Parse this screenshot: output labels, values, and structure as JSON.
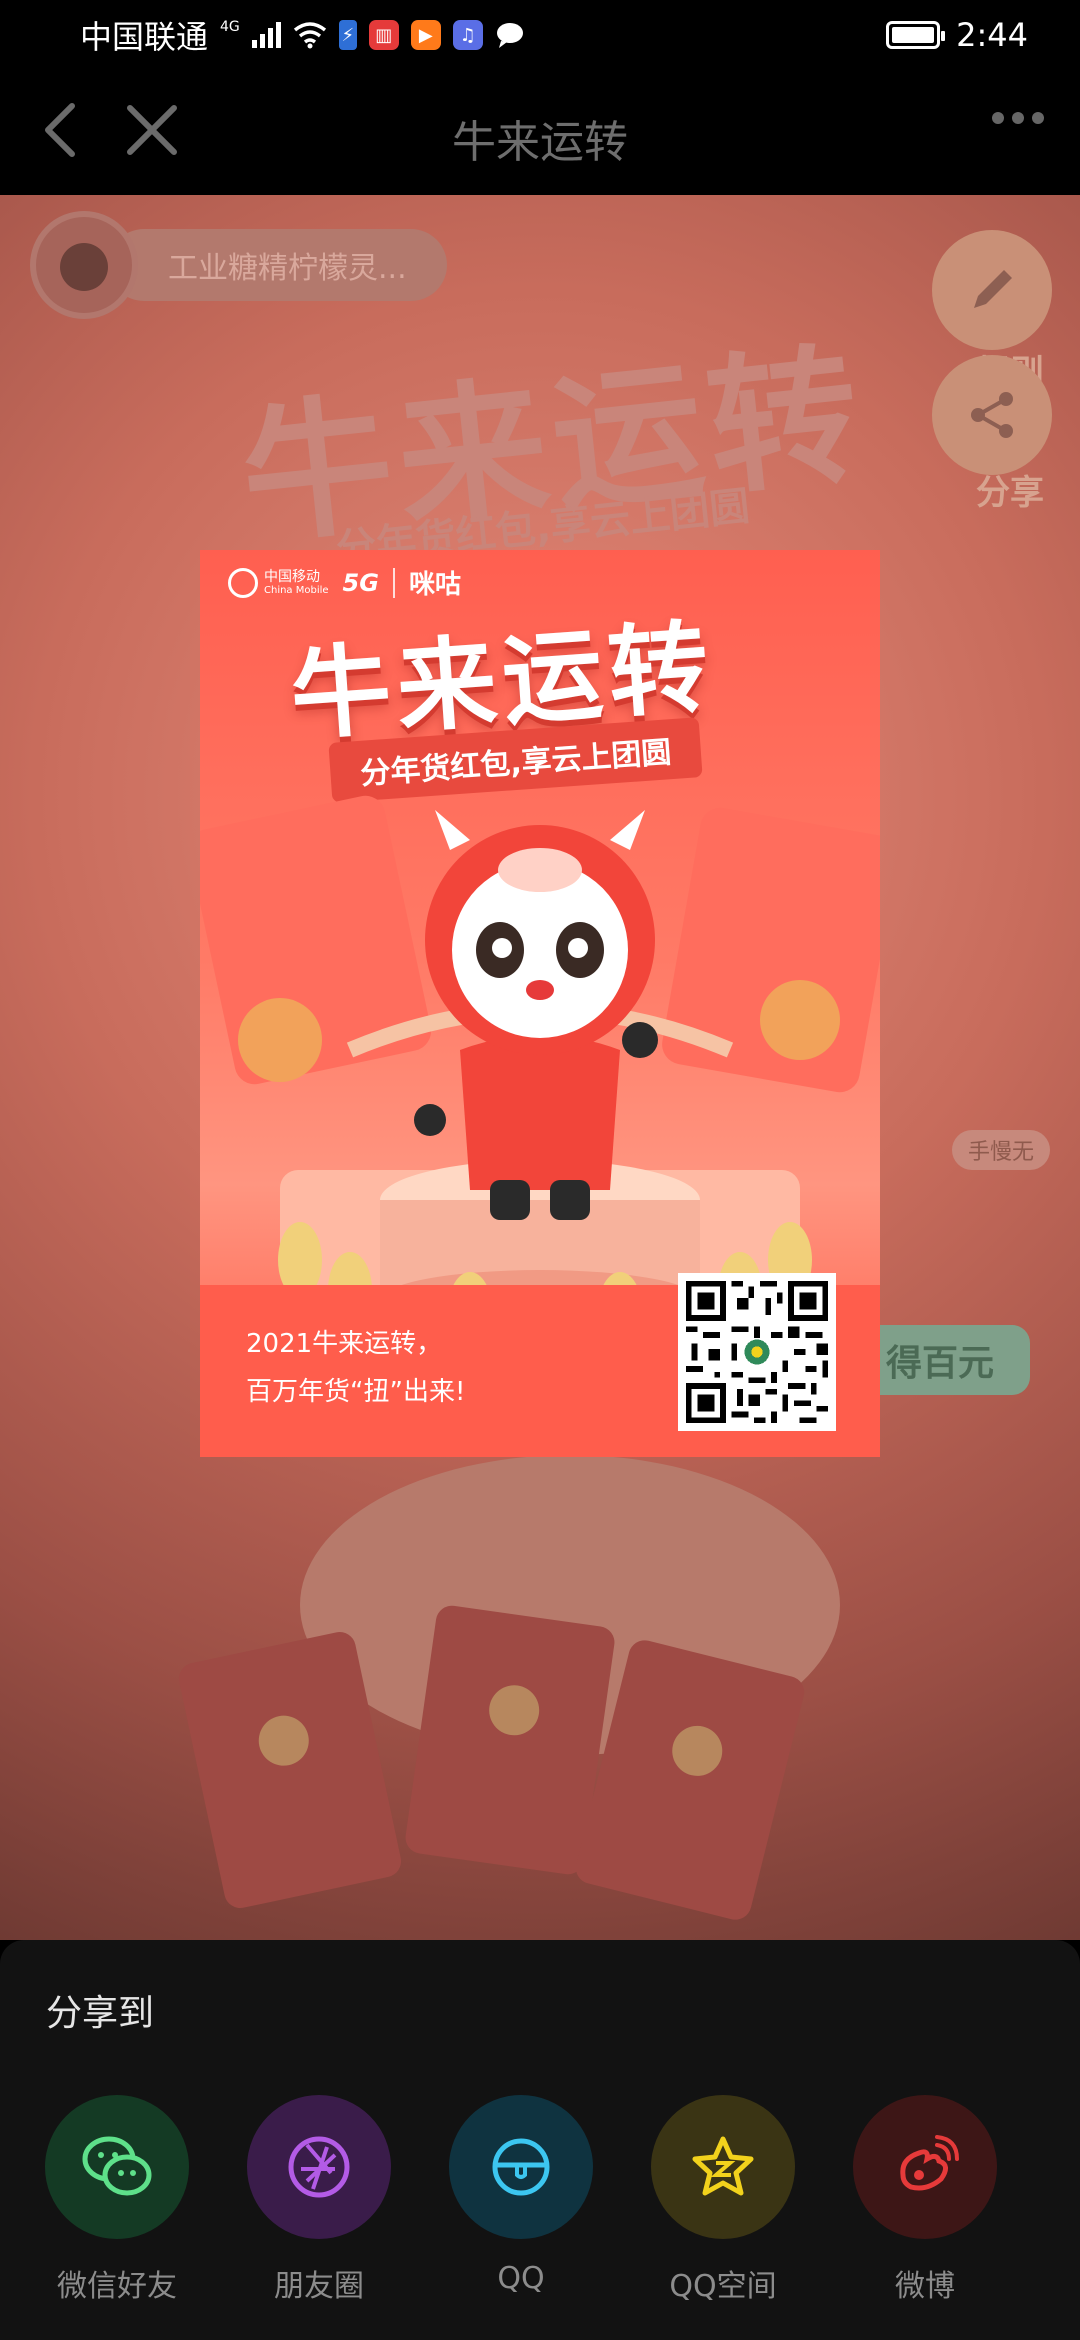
{
  "status_bar": {
    "carrier": "中国联通",
    "network": "4G",
    "time": "2:44"
  },
  "nav": {
    "title": "牛来运转"
  },
  "background_page": {
    "username": "工业糖精柠檬灵...",
    "title": "牛来运转",
    "subtitle": "分年货红包,享云上团圆",
    "rules_label": "规则",
    "share_label": "分享",
    "badge": "手慢无",
    "pill": "得百元"
  },
  "poster": {
    "brand": {
      "cm_cn": "中国移动",
      "cm_en": "China Mobile",
      "fiveg": "5G",
      "migu": "咪咕"
    },
    "title": "牛来运转",
    "subtitle": "分年货红包,享云上团圆",
    "tagline_line1": "2021牛来运转，",
    "tagline_line2": "百万年货“扭”出来!"
  },
  "share_sheet": {
    "title": "分享到",
    "items": [
      {
        "label": "微信好友",
        "icon": "wechat-friends-icon",
        "bg": "#143a24",
        "fg": "#5ee08a"
      },
      {
        "label": "朋友圈",
        "icon": "moments-icon",
        "bg": "#3a1c4a",
        "fg": "#b35be6"
      },
      {
        "label": "QQ",
        "icon": "qq-icon",
        "bg": "#0f3340",
        "fg": "#3cc6f0"
      },
      {
        "label": "QQ空间",
        "icon": "qzone-icon",
        "bg": "#3a3414",
        "fg": "#f2d21c"
      },
      {
        "label": "微博",
        "icon": "weibo-icon",
        "bg": "#3d1616",
        "fg": "#e63a3a"
      }
    ]
  }
}
